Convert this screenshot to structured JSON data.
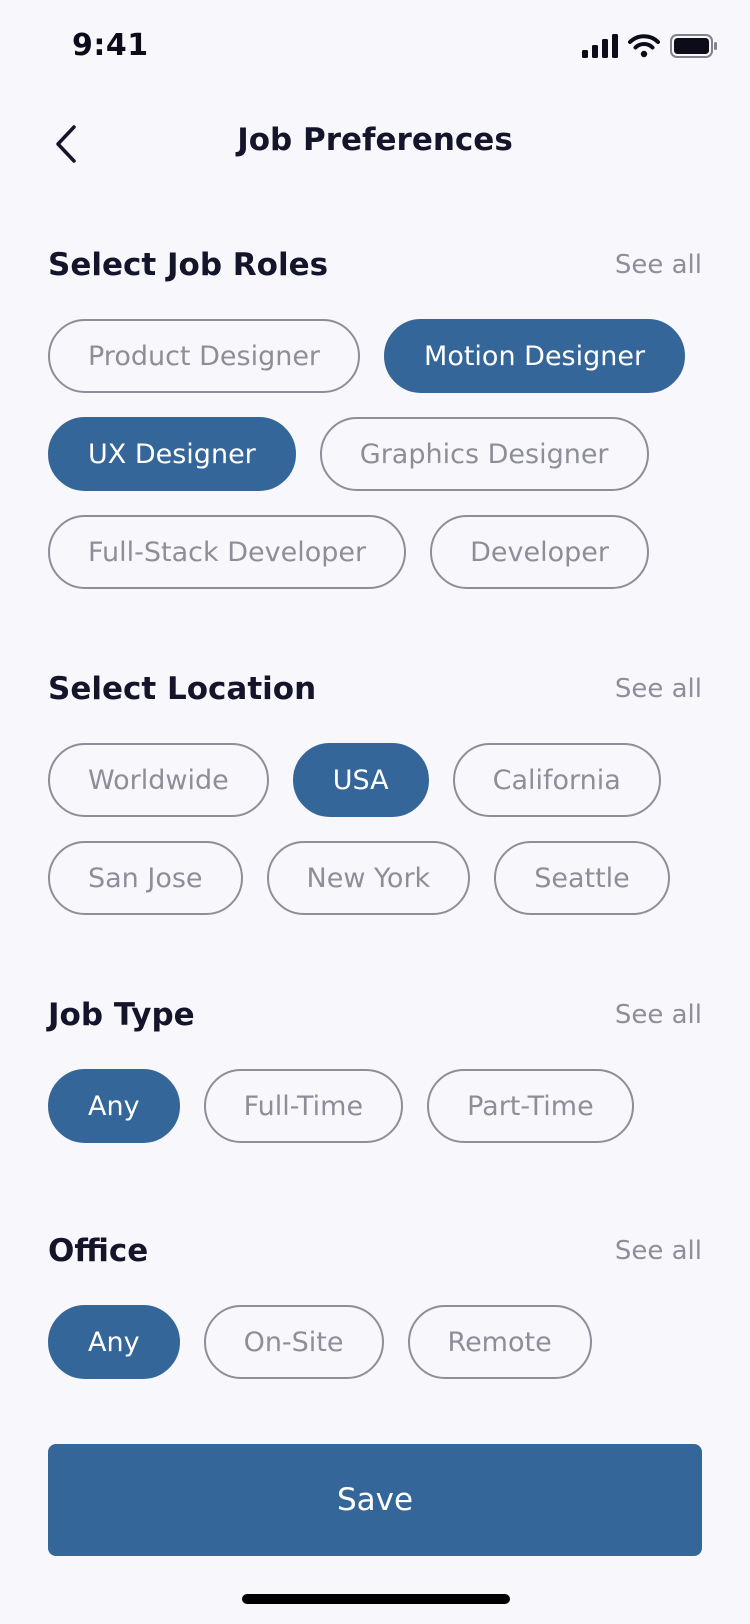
{
  "status_bar": {
    "time": "9:41"
  },
  "header": {
    "title": "Job Preferences"
  },
  "sections": [
    {
      "title": "Select Job Roles",
      "see_all": "See all",
      "chips": [
        {
          "label": "Product Designer",
          "selected": false
        },
        {
          "label": "Motion Designer",
          "selected": true
        },
        {
          "label": "UX Designer",
          "selected": true
        },
        {
          "label": "Graphics Designer",
          "selected": false
        },
        {
          "label": "Full-Stack Developer",
          "selected": false
        },
        {
          "label": "Developer",
          "selected": false
        }
      ]
    },
    {
      "title": "Select Location",
      "see_all": "See all",
      "chips": [
        {
          "label": "Worldwide",
          "selected": false
        },
        {
          "label": "USA",
          "selected": true
        },
        {
          "label": "California",
          "selected": false
        },
        {
          "label": "San Jose",
          "selected": false
        },
        {
          "label": "New York",
          "selected": false
        },
        {
          "label": "Seattle",
          "selected": false
        }
      ]
    },
    {
      "title": "Job Type",
      "see_all": "See all",
      "chips": [
        {
          "label": "Any",
          "selected": true
        },
        {
          "label": "Full-Time",
          "selected": false
        },
        {
          "label": "Part-Time",
          "selected": false
        }
      ]
    },
    {
      "title": "Office",
      "see_all": "See all",
      "chips": [
        {
          "label": "Any",
          "selected": true
        },
        {
          "label": "On-Site",
          "selected": false
        },
        {
          "label": "Remote",
          "selected": false
        }
      ]
    }
  ],
  "save_button": {
    "label": "Save"
  },
  "colors": {
    "accent": "#356699",
    "background": "#F8F8FC",
    "chip_border": "#8E8E99",
    "text_dark": "#14142B"
  },
  "icons": {
    "back": "chevron-left-icon",
    "signal": "cellular-signal-icon",
    "wifi": "wifi-icon",
    "battery": "battery-icon"
  }
}
